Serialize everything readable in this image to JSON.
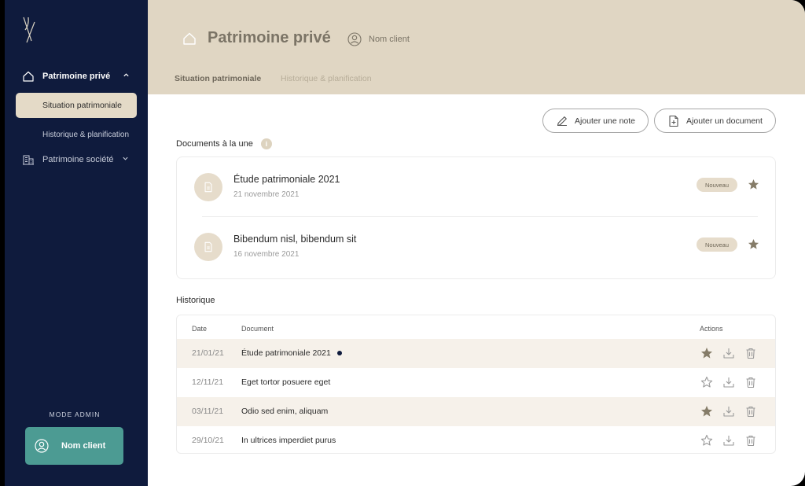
{
  "sidebar": {
    "items": [
      {
        "label": "Patrimoine privé"
      },
      {
        "label": "Situation patrimoniale"
      },
      {
        "label": "Historique & planification"
      },
      {
        "label": "Patrimoine société"
      }
    ],
    "mode_admin": "MODE ADMIN",
    "client_button": "Nom client"
  },
  "header": {
    "title": "Patrimoine privé",
    "user": "Nom client",
    "tabs": [
      {
        "label": "Situation patrimoniale",
        "active": true
      },
      {
        "label": "Historique & planification",
        "active": false
      }
    ]
  },
  "actions": {
    "add_note": "Ajouter une note",
    "add_document": "Ajouter un document"
  },
  "featured": {
    "title": "Documents à la une",
    "info": "i",
    "items": [
      {
        "title": "Étude patrimoniale 2021",
        "date": "21 novembre 2021",
        "badge": "Nouveau"
      },
      {
        "title": "Bibendum nisl, bibendum sit",
        "date": "16 novembre 2021",
        "badge": "Nouveau"
      }
    ]
  },
  "history": {
    "title": "Historique",
    "columns": {
      "date": "Date",
      "document": "Document",
      "actions": "Actions"
    },
    "rows": [
      {
        "date": "21/01/21",
        "document": "Étude patrimoniale 2021",
        "starred": true,
        "is_new": true
      },
      {
        "date": "12/11/21",
        "document": "Eget tortor posuere eget",
        "starred": false,
        "is_new": false
      },
      {
        "date": "03/11/21",
        "document": "Odio sed enim, aliquam",
        "starred": true,
        "is_new": false
      },
      {
        "date": "29/10/21",
        "document": "In ultrices imperdiet purus",
        "starred": false,
        "is_new": false
      }
    ]
  },
  "colors": {
    "sidebar": "#0f1b3d",
    "header": "#e0d6c3",
    "accent": "#4c9b93",
    "row_alt": "#f6f1ea"
  }
}
